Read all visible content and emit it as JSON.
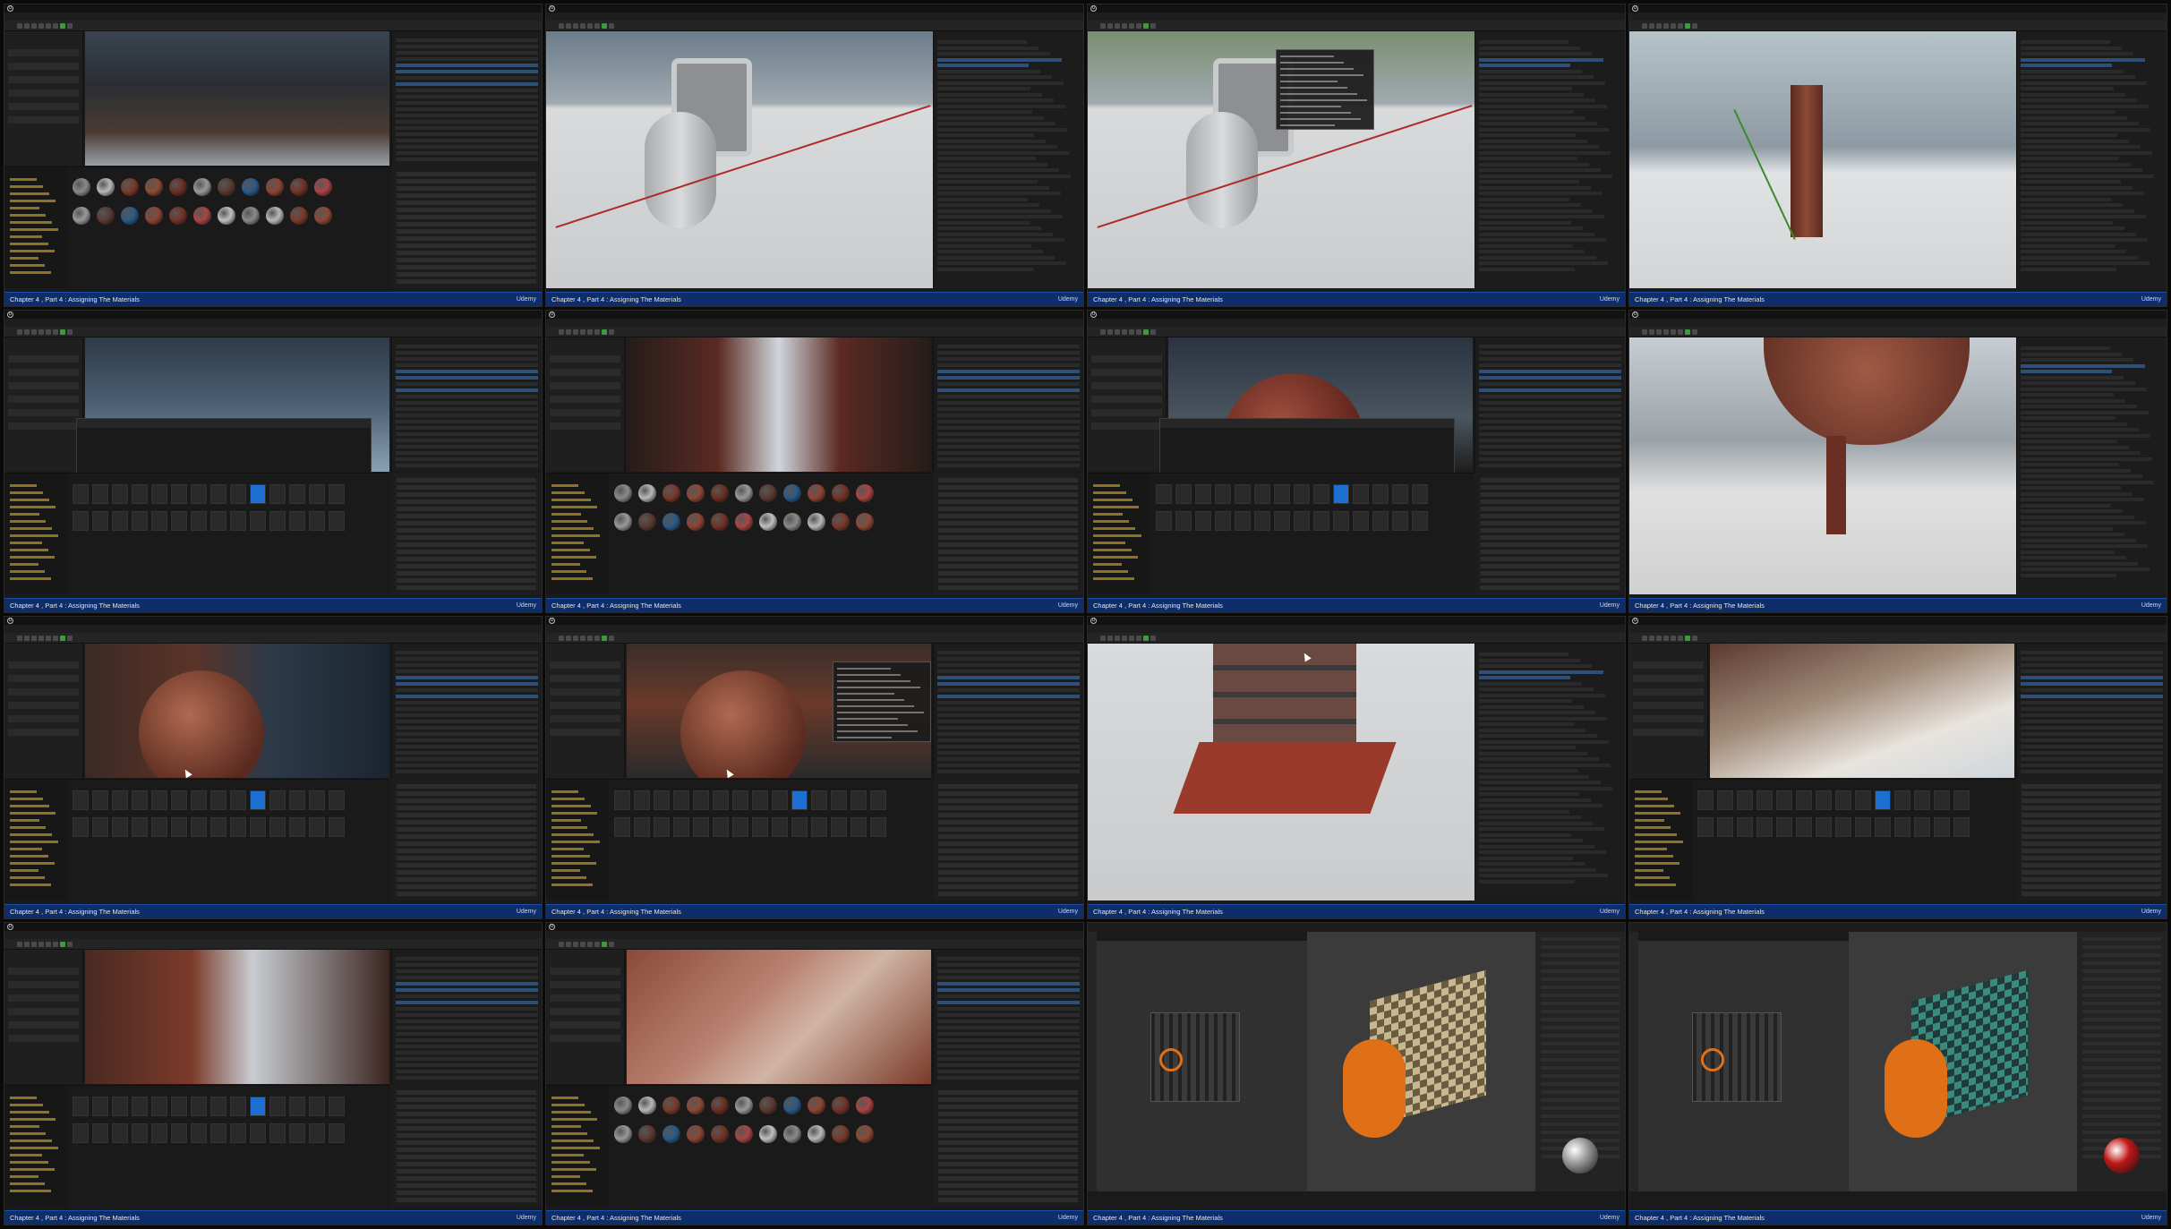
{
  "caption": {
    "text": "Chapter 4 , Part 4 : Assigning The Materials",
    "brand": "Udemy"
  },
  "colors": {
    "caption_bar": "#0d2d6b",
    "selection_blue": "#1d6fd1",
    "play_green": "#3f9a3f",
    "folder_gold": "#c59a2a",
    "rust": "#7a3a2a",
    "blender_orange": "#e07018"
  },
  "icons": {
    "logo": "unreal-logo-icon",
    "play": "play-icon",
    "cursor": "mouse-cursor-icon"
  },
  "thumbnails": [
    {
      "id": "t1",
      "scene": "factory-interior-viewport",
      "layout": "editor"
    },
    {
      "id": "t2",
      "scene": "duct-pipe-untextured",
      "layout": "asset-editor"
    },
    {
      "id": "t3",
      "scene": "duct-pipe-tooltip",
      "layout": "asset-editor"
    },
    {
      "id": "t4",
      "scene": "rusted-column",
      "layout": "asset-editor"
    },
    {
      "id": "t5",
      "scene": "catwalk-floating-window",
      "layout": "editor"
    },
    {
      "id": "t6",
      "scene": "corridor-materials",
      "layout": "editor"
    },
    {
      "id": "t7",
      "scene": "brick-sphere-material",
      "layout": "editor"
    },
    {
      "id": "t8",
      "scene": "rusted-tank-legs",
      "layout": "asset-editor"
    },
    {
      "id": "t9",
      "scene": "bellows-tank",
      "layout": "editor"
    },
    {
      "id": "t10",
      "scene": "dome-tank-tooltip",
      "layout": "editor"
    },
    {
      "id": "t11",
      "scene": "stacked-brick-base",
      "layout": "asset-editor"
    },
    {
      "id": "t12",
      "scene": "ceiling-window",
      "layout": "editor"
    },
    {
      "id": "t13",
      "scene": "hallway-rust",
      "layout": "editor"
    },
    {
      "id": "t14",
      "scene": "rust-floor-topdown",
      "layout": "editor"
    },
    {
      "id": "t15",
      "scene": "blender-uv-checker",
      "layout": "blender"
    },
    {
      "id": "t16",
      "scene": "blender-uv-teal",
      "layout": "blender"
    }
  ]
}
